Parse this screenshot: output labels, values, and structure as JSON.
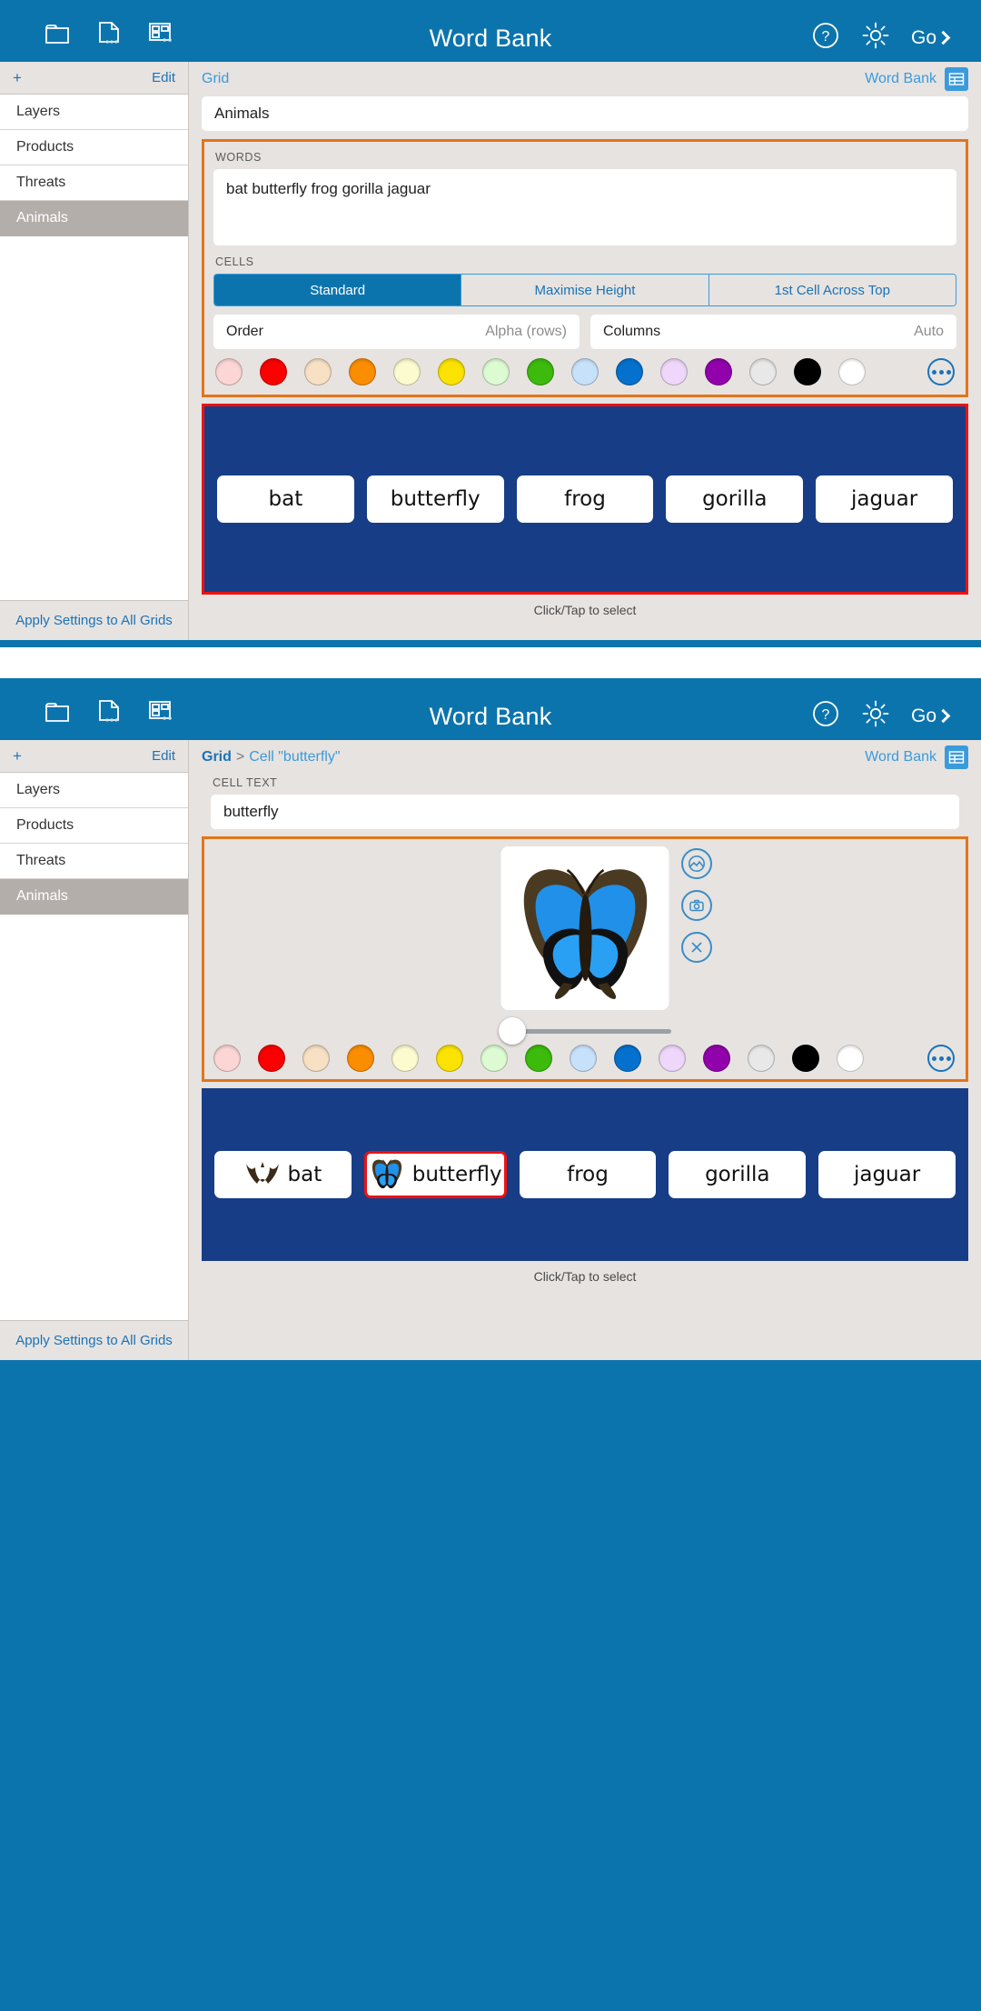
{
  "app": {
    "title": "Word Bank",
    "toolbar_left_icons": [
      "folder-icon",
      "document-options-icon",
      "grid-options-icon"
    ],
    "help_label": "?",
    "settings_label": "gear-icon",
    "go_label": "Go"
  },
  "sidebar": {
    "add_label": "+",
    "edit_label": "Edit",
    "items": [
      {
        "label": "Layers",
        "selected": false
      },
      {
        "label": "Products",
        "selected": false
      },
      {
        "label": "Threats",
        "selected": false
      },
      {
        "label": "Animals",
        "selected": true
      }
    ],
    "footer_label": "Apply Settings to All Grids"
  },
  "panel_grid": {
    "breadcrumb": {
      "root": "Grid",
      "separator": "",
      "leaf": ""
    },
    "word_bank_label": "Word Bank",
    "grid_name": "Animals",
    "words_section_label": "WORDS",
    "words_value": "bat butterfly frog gorilla jaguar",
    "cells_section_label": "CELLS",
    "cell_modes": [
      {
        "label": "Standard",
        "active": true
      },
      {
        "label": "Maximise Height",
        "active": false
      },
      {
        "label": "1st Cell Across Top",
        "active": false
      }
    ],
    "order_label": "Order",
    "order_value": "Alpha (rows)",
    "columns_label": "Columns",
    "columns_value": "Auto",
    "preview_cells": [
      {
        "text": "bat",
        "icon": "",
        "selected": false
      },
      {
        "text": "butterfly",
        "icon": "",
        "selected": false
      },
      {
        "text": "frog",
        "icon": "",
        "selected": false
      },
      {
        "text": "gorilla",
        "icon": "",
        "selected": false
      },
      {
        "text": "jaguar",
        "icon": "",
        "selected": false
      }
    ],
    "hint": "Click/Tap to select"
  },
  "panel_cell": {
    "breadcrumb": {
      "root": "Grid",
      "separator": ">",
      "leaf": "Cell \"butterfly\""
    },
    "word_bank_label": "Word Bank",
    "cell_text_label": "CELL TEXT",
    "cell_text_value": "butterfly",
    "tools": [
      {
        "name": "picture-icon"
      },
      {
        "name": "camera-icon"
      },
      {
        "name": "remove-icon"
      }
    ],
    "image_alt": "butterfly-image",
    "slider_value": 0,
    "preview_cells": [
      {
        "text": "bat",
        "icon": "bat-icon",
        "selected": false
      },
      {
        "text": "butterfly",
        "icon": "butterfly-icon",
        "selected": true
      },
      {
        "text": "frog",
        "icon": "",
        "selected": false
      },
      {
        "text": "gorilla",
        "icon": "",
        "selected": false
      },
      {
        "text": "jaguar",
        "icon": "",
        "selected": false
      }
    ],
    "hint": "Click/Tap to select"
  },
  "colors": {
    "accent_blue": "#0c74ad",
    "link_blue": "#1b73b8",
    "highlight_orange": "#e2751a",
    "selection_red": "#ee1111",
    "grid_background": "#173d87",
    "swatches": [
      "#fcd5d5",
      "#fb0000",
      "#f7e0c4",
      "#fb8d00",
      "#fcfbd0",
      "#fbe200",
      "#ddfbd2",
      "#3cbb0d",
      "#c8e1fb",
      "#0571ce",
      "#eed7fb",
      "#9202ac",
      "#e8e8e8",
      "#000000",
      "#ffffff"
    ],
    "more_label": "more-colors"
  }
}
